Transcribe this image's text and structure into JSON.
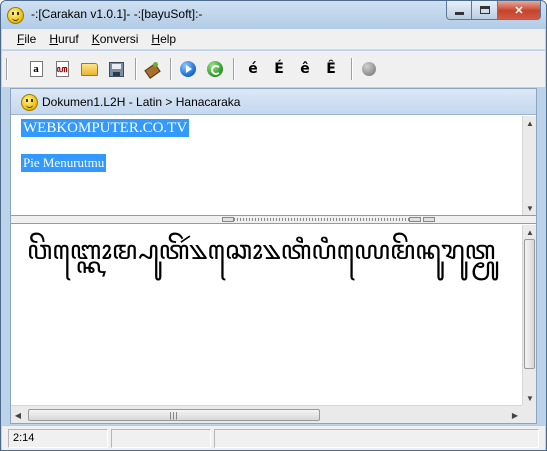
{
  "window": {
    "title": "-:[Carakan v1.0.1]- -:[bayuSoft]:-"
  },
  "menu": {
    "items": [
      {
        "label": "File",
        "accel": "F",
        "rest": "ile"
      },
      {
        "label": "Huruf",
        "accel": "H",
        "rest": "uruf"
      },
      {
        "label": "Konversi",
        "accel": "K",
        "rest": "onversi"
      },
      {
        "label": "Help",
        "accel": "H",
        "rest": "elp"
      }
    ]
  },
  "toolbar": {
    "new_latin_glyph": "a",
    "new_java_glyph": "ꦲ",
    "letters": [
      "é",
      "É",
      "ê",
      "Ê"
    ],
    "icons": [
      "new-latin-document-icon",
      "new-javanese-document-icon",
      "open-folder-icon",
      "save-disk-icon",
      "clear-brush-icon",
      "convert-play-icon",
      "refresh-icon",
      "stop-icon"
    ]
  },
  "document": {
    "title": "Dokumen1.L2H - Latin > Hanacaraka",
    "latin_lines": [
      "WEBKOMPUTER.CO.TV",
      "Pie Menurutmu"
    ],
    "javanese_text": "ꦮꦼꦧ꧀ꦏꦺꦴꦩ꧀ꦥꦸꦠꦼꦂ꧉ꦕꦺꦴ꧉ꦠꦶꦥꦶꦪꦺꦩꦼꦤꦸꦫꦸꦠ꧀ꦩꦸ"
  },
  "status": {
    "cursor": "2:14",
    "panel2": "",
    "panel3": ""
  },
  "colors": {
    "selection": "#3399ff",
    "title_gradient_top": "#cfe0f2",
    "close_button": "#c5432c"
  }
}
